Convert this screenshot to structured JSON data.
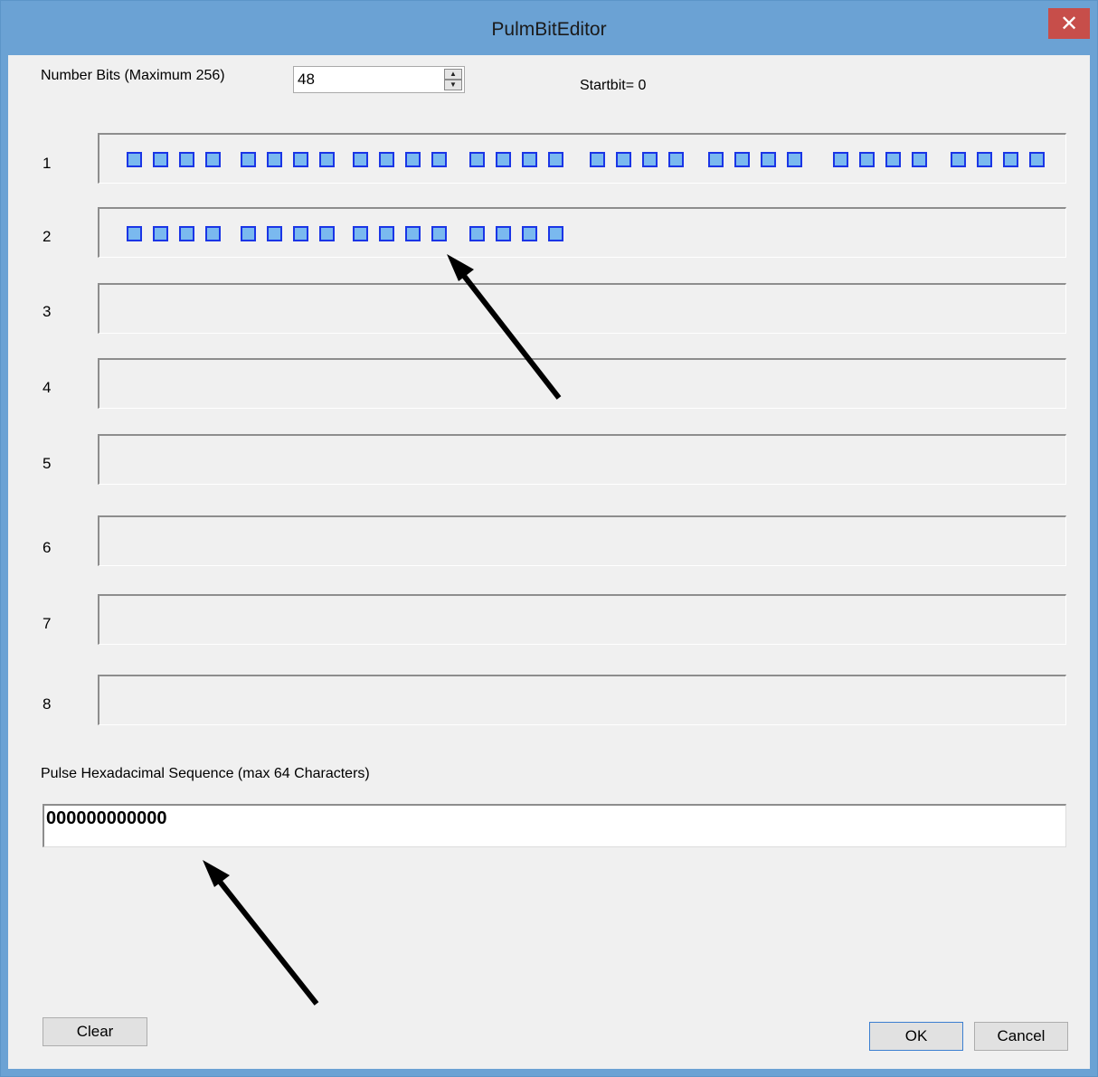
{
  "window": {
    "title": "PulmBitEditor",
    "close_glyph": "✕"
  },
  "number_bits": {
    "label": "Number Bits (Maximum 256)",
    "value": "48"
  },
  "startbit_text": "Startbit= 0",
  "rows": [
    {
      "label": "1",
      "bit_count": 32
    },
    {
      "label": "2",
      "bit_count": 16
    },
    {
      "label": "3",
      "bit_count": 0
    },
    {
      "label": "4",
      "bit_count": 0
    },
    {
      "label": "5",
      "bit_count": 0
    },
    {
      "label": "6",
      "bit_count": 0
    },
    {
      "label": "7",
      "bit_count": 0
    },
    {
      "label": "8",
      "bit_count": 0
    }
  ],
  "hex": {
    "label": "Pulse Hexadacimal Sequence (max 64 Characters)",
    "value": "000000000000"
  },
  "buttons": {
    "clear": "Clear",
    "ok": "OK",
    "cancel": "Cancel"
  },
  "icons": {
    "spin_up": "spin-up-icon",
    "spin_down": "spin-down-icon",
    "close": "close-icon",
    "annotation": "arrow-annotation"
  },
  "colors": {
    "titlebar": "#6ba2d4",
    "close": "#c74e4a",
    "bit_fill": "#7ab9ef",
    "bit_border": "#1a35e6",
    "background": "#f0f0f0"
  }
}
